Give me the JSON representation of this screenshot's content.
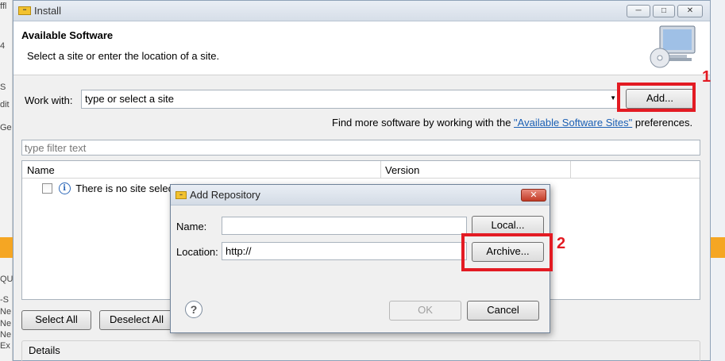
{
  "background": {
    "left_fragments": [
      "ffl",
      "4",
      "S",
      "dit",
      "Ge",
      "QU",
      "-S",
      "Ne",
      "Ne",
      "Ne",
      "Ex"
    ]
  },
  "window": {
    "title": "Install",
    "app_icon": "eclipse-app-icon",
    "min_btn": "─",
    "max_btn": "□",
    "close_btn": "✕"
  },
  "header": {
    "title": "Available Software",
    "subtitle": "Select a site or enter the location of a site.",
    "icon": "monitor-cd-icon"
  },
  "work_with": {
    "label": "Work with:",
    "value": "type or select a site",
    "add_button": "Add..."
  },
  "more_software": {
    "prefix": "Find more software by working with the ",
    "link": "\"Available Software Sites\"",
    "suffix": " preferences."
  },
  "filter": {
    "placeholder": "type filter text"
  },
  "table": {
    "columns": [
      "Name",
      "Version"
    ],
    "rows": [
      {
        "checked": false,
        "icon": "info-icon",
        "name": "There is no site selected."
      }
    ]
  },
  "buttons": {
    "select_all": "Select All",
    "deselect_all": "Deselect All"
  },
  "details": {
    "label": "Details"
  },
  "add_repository": {
    "title": "Add Repository",
    "name_label": "Name:",
    "name_value": "",
    "location_label": "Location:",
    "location_value": "http://",
    "local_button": "Local...",
    "archive_button": "Archive...",
    "ok_button": "OK",
    "cancel_button": "Cancel",
    "help": "?"
  },
  "annotations": {
    "marker1": "1",
    "marker2": "2",
    "color": "#e31b23"
  }
}
